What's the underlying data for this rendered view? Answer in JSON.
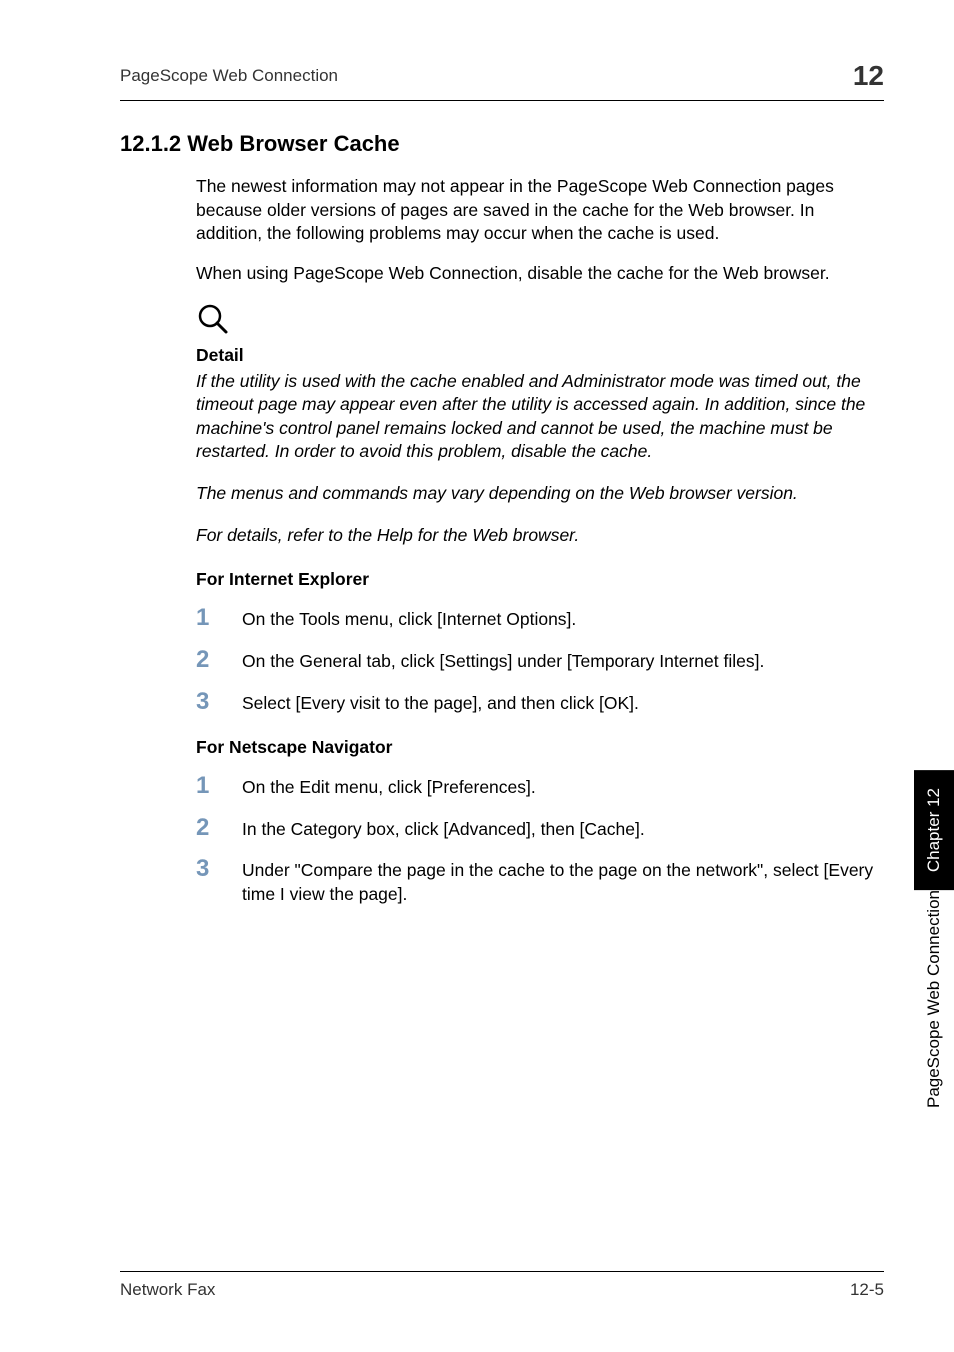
{
  "header": {
    "left": "PageScope Web Connection",
    "right": "12"
  },
  "section": {
    "title": "12.1.2  Web Browser Cache",
    "intro_paragraphs": [
      "The newest information may not appear in the PageScope Web Connection pages because older versions of pages are saved in the cache for the Web browser. In addition, the following problems may occur when the cache is used.",
      "When using PageScope Web Connection, disable the cache for the Web browser."
    ],
    "detail_label": "Detail",
    "detail_paragraphs": [
      "If the utility is used with the cache enabled and Administrator mode was timed out, the timeout page may appear even after the utility is accessed again. In addition, since the machine's control panel remains locked and cannot be used, the machine must be restarted. In order to avoid this problem, disable the cache.",
      "The menus and commands may vary depending on the Web browser version.",
      "For details, refer to the Help for the Web browser."
    ],
    "ie_head": "For Internet Explorer",
    "ie_steps": [
      "On the Tools menu, click [Internet Options].",
      "On the General tab, click [Settings] under [Temporary Internet files].",
      "Select [Every visit to the page], and then click [OK]."
    ],
    "netscape_head": "For Netscape Navigator",
    "netscape_steps": [
      "On the Edit menu, click [Preferences].",
      "In the Category box, click [Advanced], then [Cache].",
      "Under \"Compare the page in the cache to the page on the network\", select [Every time I view the page]."
    ]
  },
  "side": {
    "chapter": "Chapter 12",
    "section": "PageScope Web Connection"
  },
  "footer": {
    "left": "Network Fax",
    "right": "12-5"
  },
  "step_numbers": [
    "1",
    "2",
    "3"
  ]
}
